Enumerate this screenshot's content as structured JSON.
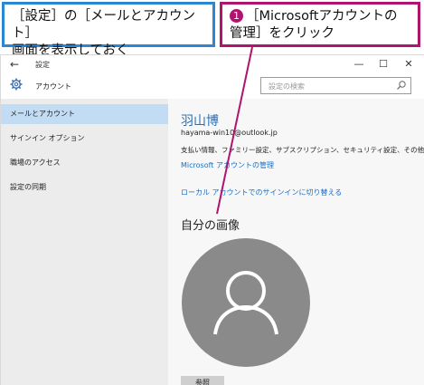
{
  "callouts": {
    "left": {
      "line1": "［設定］の［メールとアカウント］",
      "line2": "画面を表示しておく"
    },
    "right": {
      "badge": "1",
      "line1": "［Microsoftアカウントの",
      "line2": "管理］をクリック"
    }
  },
  "window": {
    "title": "設定",
    "back_glyph": "←",
    "minimize_glyph": "—",
    "maximize_glyph": "☐",
    "close_glyph": "✕"
  },
  "header": {
    "title": "アカウント",
    "search_placeholder": "設定の検索"
  },
  "sidebar": {
    "items": [
      {
        "label": "メールとアカウント",
        "selected": true
      },
      {
        "label": "サインイン オプション",
        "selected": false
      },
      {
        "label": "職場のアクセス",
        "selected": false
      },
      {
        "label": "設定の同期",
        "selected": false
      }
    ]
  },
  "account": {
    "name": "羽山博",
    "email": "hayama-win10@outlook.jp",
    "payment_info": "支払い情報、ファミリー設定、サブスクリプション、セキュリティ設定、その他",
    "manage_link": "Microsoft アカウントの管理",
    "local_link": "ローカル アカウントでのサインインに切り替える"
  },
  "picture": {
    "heading": "自分の画像",
    "browse_button": "参照"
  },
  "colors": {
    "callout_left_border": "#2b86d3",
    "callout_right_border": "#b0146e",
    "link": "#1a6fc4",
    "name": "#2b6fb5",
    "selected_nav": "#c2ddf3",
    "avatar_bg": "#8a8a8a"
  }
}
